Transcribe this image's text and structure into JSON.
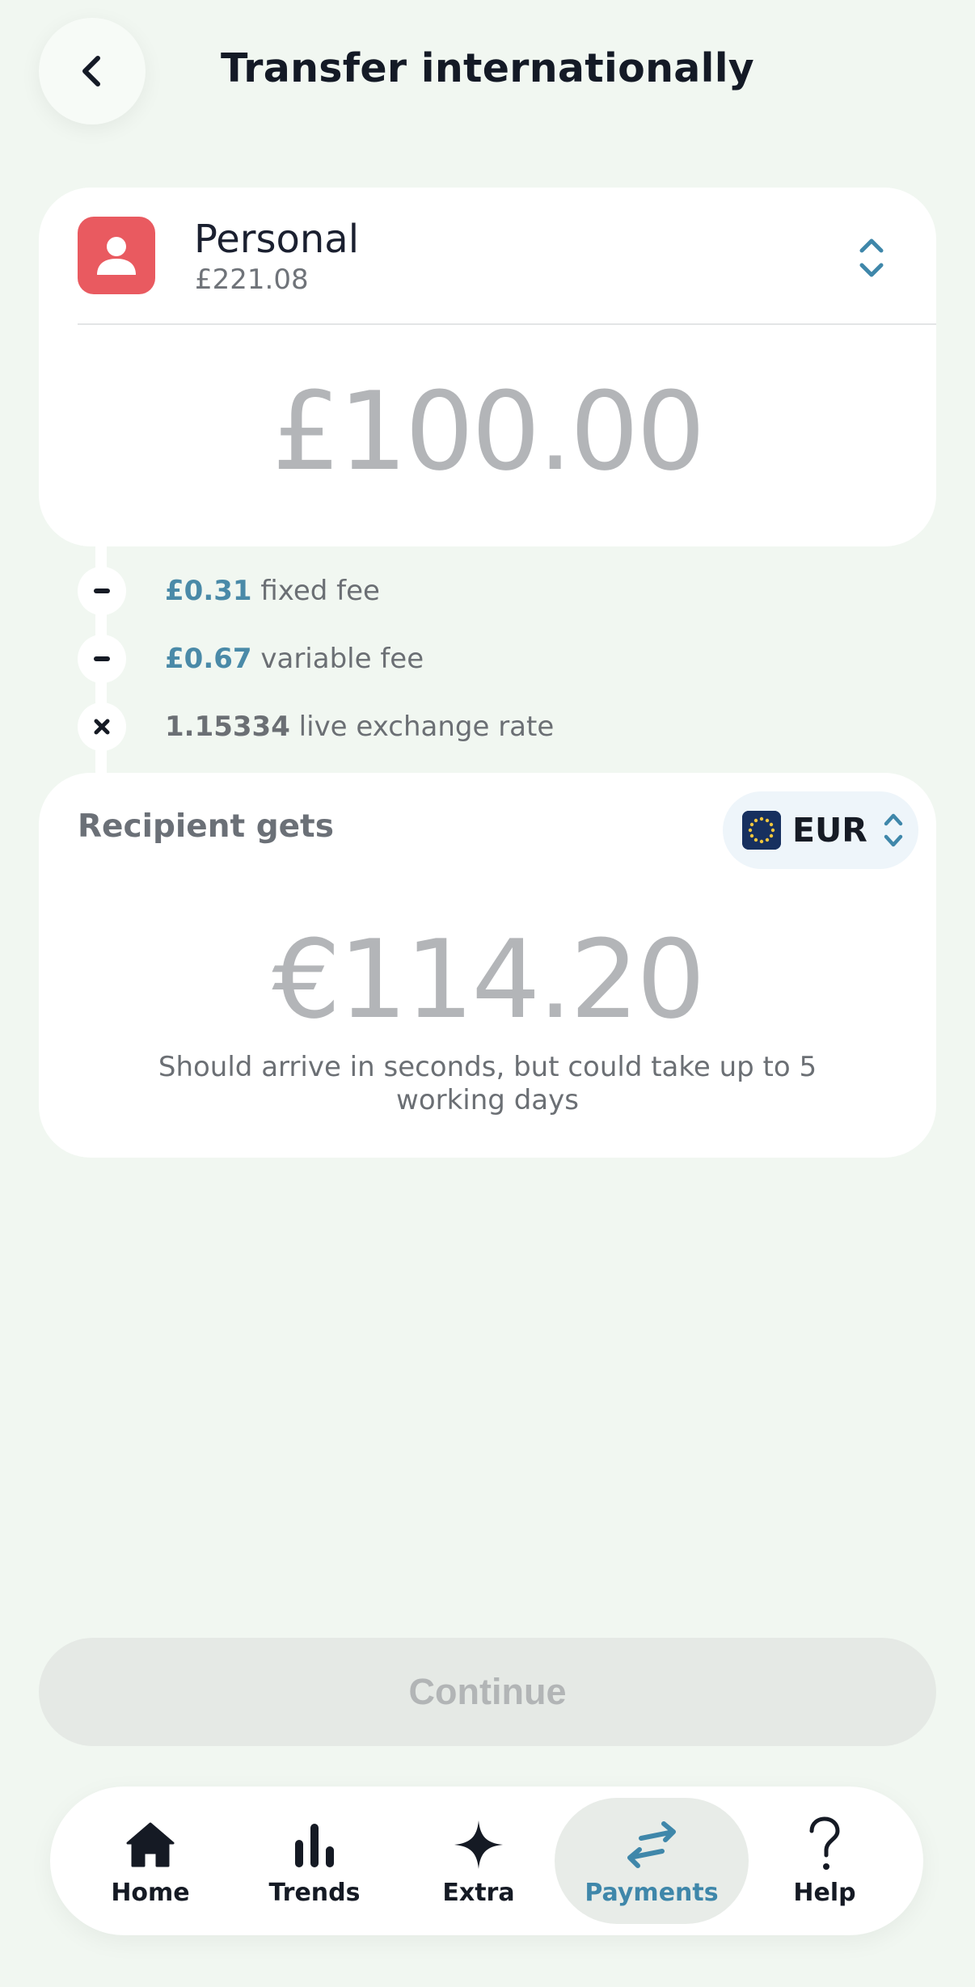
{
  "header": {
    "title": "Transfer internationally",
    "back_icon": "chevron-left-icon"
  },
  "source": {
    "account_name": "Personal",
    "balance": "£221.08",
    "avatar_color": "#e95a60",
    "amount": "£100.00"
  },
  "fees": [
    {
      "operator": "minus",
      "amount": "£0.31",
      "label": "fixed fee"
    },
    {
      "operator": "minus",
      "amount": "£0.67",
      "label": "variable fee"
    },
    {
      "operator": "times",
      "amount": "1.15334",
      "label": "live exchange rate"
    }
  ],
  "recipient": {
    "label": "Recipient gets",
    "currency": "EUR",
    "amount": "€114.20",
    "note": "Should arrive in seconds, but could take up to 5 working days"
  },
  "continue_label": "Continue",
  "nav": {
    "items": [
      {
        "label": "Home",
        "icon": "home-icon"
      },
      {
        "label": "Trends",
        "icon": "bar-chart-icon"
      },
      {
        "label": "Extra",
        "icon": "sparkle-icon"
      },
      {
        "label": "Payments",
        "icon": "transfer-arrows-icon",
        "active": true
      },
      {
        "label": "Help",
        "icon": "question-icon"
      }
    ]
  },
  "colors": {
    "accent": "#3f87aa",
    "background": "#f1f7f1",
    "muted_amount": "#b3b5b8"
  }
}
